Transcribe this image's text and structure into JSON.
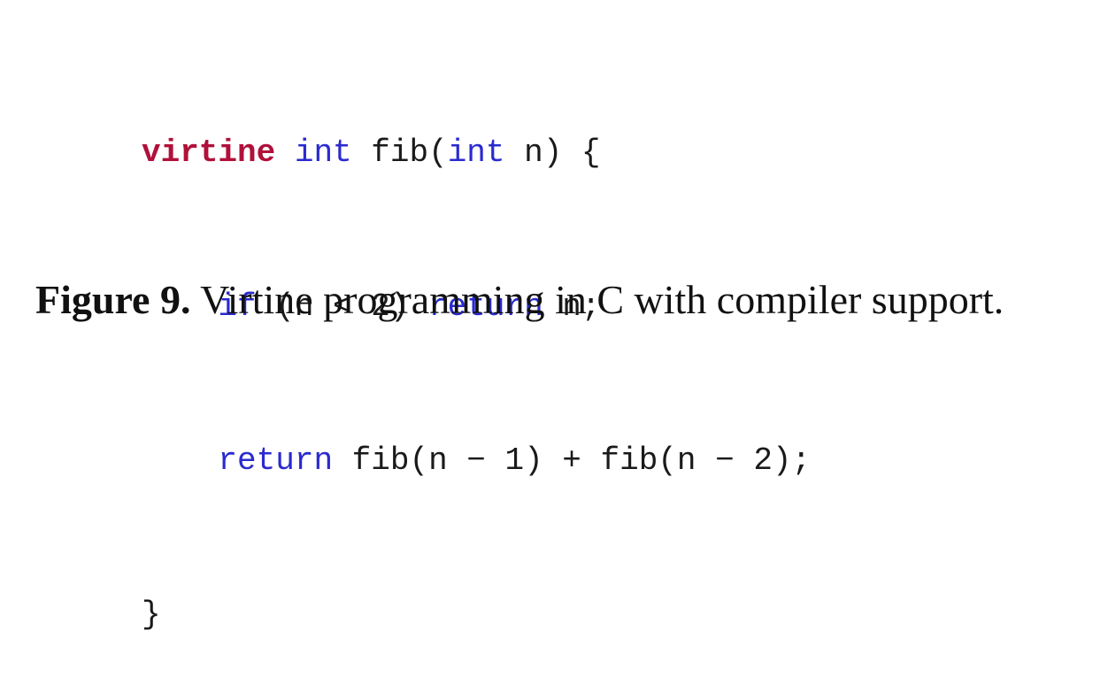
{
  "code": {
    "lines": [
      {
        "tokens": [
          {
            "text": "virtine",
            "kind": "special"
          },
          {
            "text": " ",
            "kind": "plain"
          },
          {
            "text": "int",
            "kind": "keyword"
          },
          {
            "text": " fib(",
            "kind": "plain"
          },
          {
            "text": "int",
            "kind": "keyword"
          },
          {
            "text": " n) {",
            "kind": "plain"
          }
        ]
      },
      {
        "tokens": [
          {
            "text": "    ",
            "kind": "plain"
          },
          {
            "text": "if",
            "kind": "keyword"
          },
          {
            "text": " (n < 2) ",
            "kind": "plain"
          },
          {
            "text": "return",
            "kind": "keyword"
          },
          {
            "text": " n;",
            "kind": "plain"
          }
        ]
      },
      {
        "tokens": [
          {
            "text": "    ",
            "kind": "plain"
          },
          {
            "text": "return",
            "kind": "keyword"
          },
          {
            "text": " fib(n − 1) + fib(n − 2);",
            "kind": "plain"
          }
        ]
      },
      {
        "tokens": [
          {
            "text": "}",
            "kind": "plain"
          }
        ]
      }
    ]
  },
  "caption": {
    "label": "Figure 9.",
    "text": " Virtine programming in C with compiler support."
  },
  "colors": {
    "special_keyword": "#b0103a",
    "keyword": "#2a2acf",
    "text": "#1a1a1a"
  }
}
